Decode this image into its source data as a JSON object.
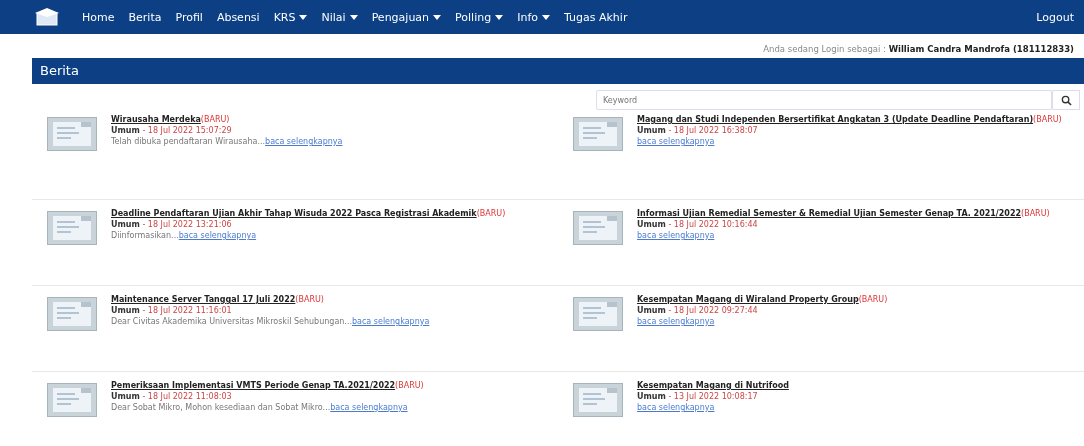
{
  "nav": {
    "items": [
      {
        "label": "Home",
        "dropdown": false
      },
      {
        "label": "Berita",
        "dropdown": false
      },
      {
        "label": "Profil",
        "dropdown": false
      },
      {
        "label": "Absensi",
        "dropdown": false
      },
      {
        "label": "KRS",
        "dropdown": true
      },
      {
        "label": "Nilai",
        "dropdown": true
      },
      {
        "label": "Pengajuan",
        "dropdown": true
      },
      {
        "label": "Polling",
        "dropdown": true
      },
      {
        "label": "Info",
        "dropdown": true
      },
      {
        "label": "Tugas Akhir",
        "dropdown": false
      }
    ],
    "logout": "Logout"
  },
  "login": {
    "prefix": "Anda sedang Login sebagai :",
    "user": "William Candra Mandrofa (181112833)"
  },
  "panel": {
    "title": "Berita",
    "search": {
      "placeholder": "Keyword"
    }
  },
  "news": [
    {
      "title": "Wirausaha Merdeka",
      "badge": "(BARU)",
      "category": "Umum",
      "date": " - 18 Jul 2022 15:07:29",
      "excerpt": "Telah dibuka pendaftaran Wirausaha...",
      "link": "baca selengkapnya"
    },
    {
      "title": "Magang dan Studi Independen Bersertifikat Angkatan 3 (Update Deadline Pendaftaran)",
      "badge": "(BARU)",
      "category": "Umum",
      "date": " - 18 Jul 2022 16:38:07",
      "link": "baca selengkapnya"
    },
    {
      "title": "Deadline Pendaftaran Ujian Akhir Tahap Wisuda 2022 Pasca Registrasi Akademik",
      "badge": "(BARU)",
      "category": "Umum",
      "date": " - 18 Jul 2022 13:21:06",
      "excerpt": "Diinformasikan...",
      "link": "baca selengkapnya"
    },
    {
      "title": "Informasi Ujian Remedial Semester & Remedial Ujian Semester Genap TA. 2021/2022",
      "badge": "(BARU)",
      "category": "Umum",
      "date": " - 18 Jul 2022 10:16:44",
      "link": "baca selengkapnya"
    },
    {
      "title": "Maintenance Server Tanggal 17 Juli 2022",
      "badge": "(BARU)",
      "category": "Umum",
      "date": " - 18 Jul 2022 11:16:01",
      "excerpt": "Dear Civitas Akademika Universitas Mikroskil Sehubungan...",
      "link": "baca selengkapnya"
    },
    {
      "title": "Kesempatan Magang di Wiraland Property Group",
      "badge": "(BARU)",
      "category": "Umum",
      "date": " - 18 Jul 2022 09:27:44",
      "link": "baca selengkapnya"
    },
    {
      "title": "Pemeriksaan Implementasi VMTS Periode Genap TA.2021/2022",
      "badge": "(BARU)",
      "category": "Umum",
      "date": " - 18 Jul 2022 11:08:03",
      "excerpt": "Dear Sobat Mikro, Mohon kesediaan dan Sobat Mikro...",
      "link": "baca selengkapnya"
    },
    {
      "title": "Kesempatan Magang di Nutrifood",
      "category": "Umum",
      "date": " - 13 Jul 2022 10:08:17",
      "link": "baca selengkapnya"
    }
  ]
}
